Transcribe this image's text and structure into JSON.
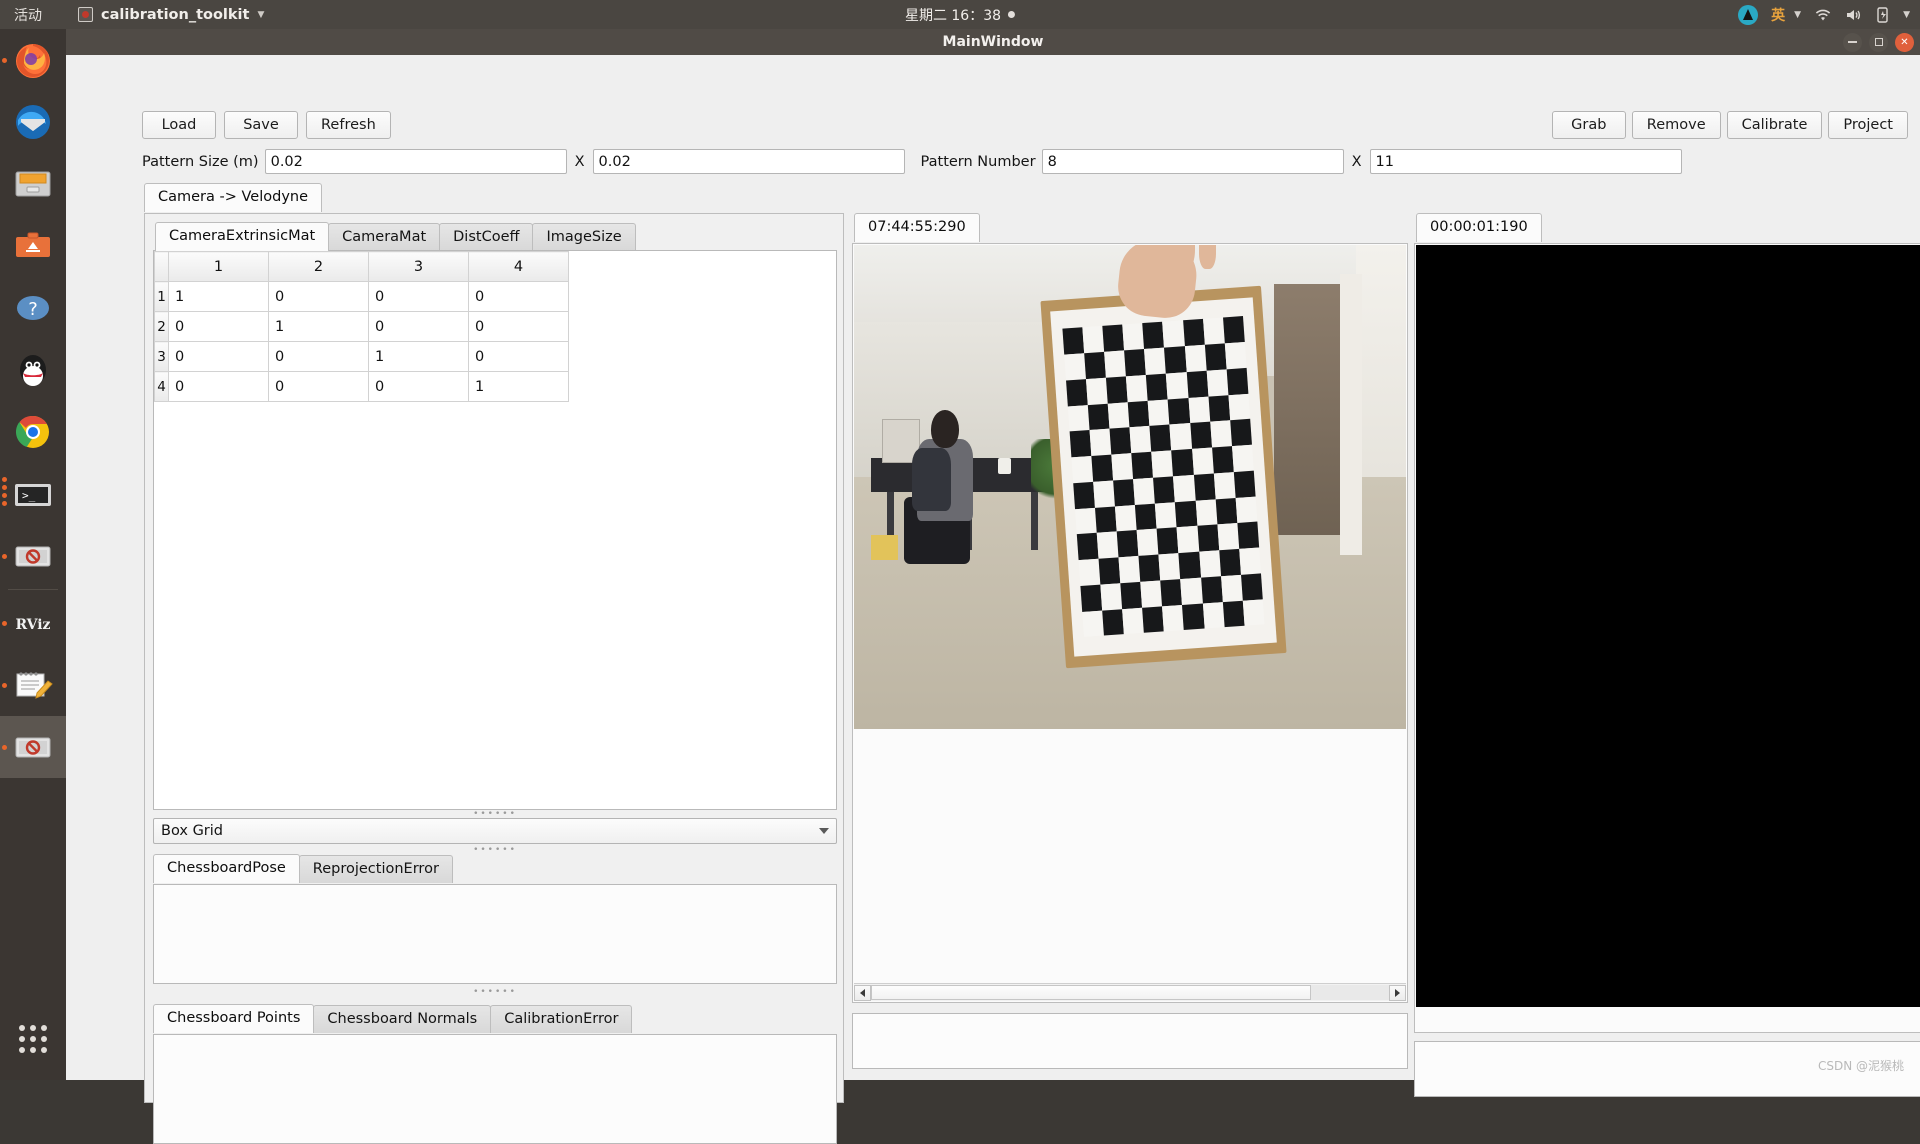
{
  "desktop": {
    "activities_label": "活动",
    "app_name": "calibration_toolkit",
    "clock": "星期二 16：38",
    "ime_label": "英",
    "dock_items": [
      {
        "name": "firefox",
        "label": "Firefox"
      },
      {
        "name": "thunderbird",
        "label": "Thunderbird Mail"
      },
      {
        "name": "files",
        "label": "Files"
      },
      {
        "name": "software",
        "label": "Ubuntu Software"
      },
      {
        "name": "help",
        "label": "Help"
      },
      {
        "name": "qq",
        "label": "QQ"
      },
      {
        "name": "chrome",
        "label": "Google Chrome"
      },
      {
        "name": "terminal",
        "label": "Terminal"
      },
      {
        "name": "calibration-app",
        "label": "calibration_toolkit"
      },
      {
        "name": "rviz",
        "label": "RViz"
      },
      {
        "name": "text-editor",
        "label": "Text Editor"
      },
      {
        "name": "calibration-toolkit-active",
        "label": "calibration_toolkit"
      }
    ]
  },
  "window": {
    "title": "MainWindow"
  },
  "toolbar": {
    "left": [
      {
        "name": "load-button",
        "label": "Load"
      },
      {
        "name": "save-button",
        "label": "Save"
      },
      {
        "name": "refresh-button",
        "label": "Refresh"
      }
    ],
    "right": [
      {
        "name": "grab-button",
        "label": "Grab"
      },
      {
        "name": "remove-button",
        "label": "Remove"
      },
      {
        "name": "calibrate-button",
        "label": "Calibrate"
      },
      {
        "name": "project-button",
        "label": "Project"
      }
    ]
  },
  "fields": {
    "pattern_size_label": "Pattern Size (m)",
    "pattern_size_x": "0.02",
    "pattern_size_sep": "X",
    "pattern_size_y": "0.02",
    "pattern_number_label": "Pattern Number",
    "pattern_number_x": "8",
    "pattern_number_sep": "X",
    "pattern_number_y": "11"
  },
  "outer_tabs": [
    {
      "name": "tab-camera-velodyne",
      "label": "Camera -> Velodyne",
      "selected": true
    }
  ],
  "inner_tabs": [
    {
      "name": "tab-camera-extrinsic-mat",
      "label": "CameraExtrinsicMat",
      "selected": true
    },
    {
      "name": "tab-camera-mat",
      "label": "CameraMat",
      "selected": false
    },
    {
      "name": "tab-dist-coeff",
      "label": "DistCoeff",
      "selected": false
    },
    {
      "name": "tab-image-size",
      "label": "ImageSize",
      "selected": false
    }
  ],
  "matrix": {
    "column_headers": [
      "1",
      "2",
      "3",
      "4"
    ],
    "row_headers": [
      "1",
      "2",
      "3",
      "4"
    ],
    "rows": [
      [
        "1",
        "0",
        "0",
        "0"
      ],
      [
        "0",
        "1",
        "0",
        "0"
      ],
      [
        "0",
        "0",
        "1",
        "0"
      ],
      [
        "0",
        "0",
        "0",
        "1"
      ]
    ]
  },
  "combo": {
    "selected": "Box Grid",
    "options": [
      "Box Grid"
    ]
  },
  "pose_tabs": [
    {
      "name": "tab-chessboard-pose",
      "label": "ChessboardPose",
      "selected": true
    },
    {
      "name": "tab-reprojection-error",
      "label": "ReprojectionError",
      "selected": false
    }
  ],
  "points_tabs": [
    {
      "name": "tab-chessboard-points",
      "label": "Chessboard Points",
      "selected": true
    },
    {
      "name": "tab-chessboard-normals",
      "label": "Chessboard Normals",
      "selected": false
    },
    {
      "name": "tab-calibration-error",
      "label": "CalibrationError",
      "selected": false
    }
  ],
  "camera_panel": {
    "tab_label": "07:44:55:290"
  },
  "lidar_panel": {
    "tab_label": "00:00:01:190"
  },
  "watermark": "CSDN @泥猴桃"
}
